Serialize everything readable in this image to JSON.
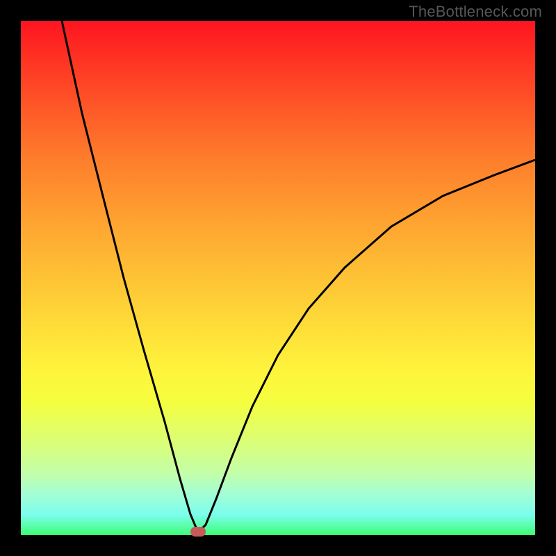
{
  "watermark": "TheBottleneck.com",
  "colors": {
    "frame_border": "#000000",
    "curve_stroke": "#000000",
    "marker_fill": "#c85a5a",
    "gradient_top": "#fe1420",
    "gradient_bottom": "#3cfe74"
  },
  "chart_data": {
    "type": "line",
    "title": "",
    "xlabel": "",
    "ylabel": "",
    "xlim": [
      0,
      100
    ],
    "ylim": [
      0,
      100
    ],
    "note": "No axis ticks or numeric labels are shown; x and y are expressed as percent of plot area. y=0 is the bottom (green/optimal), y=100 is the top (red/bottleneck).",
    "series": [
      {
        "name": "bottleneck-curve",
        "x": [
          8,
          12,
          16,
          20,
          24,
          28,
          31,
          33,
          34.5,
          36,
          38,
          41,
          45,
          50,
          56,
          63,
          72,
          82,
          92,
          100
        ],
        "y": [
          100,
          82,
          66,
          50,
          36,
          22,
          11,
          4,
          0.5,
          2,
          7,
          15,
          25,
          35,
          44,
          52,
          60,
          66,
          70,
          73
        ]
      }
    ],
    "marker": {
      "name": "optimal-point",
      "x": 34.5,
      "y": 0.5
    }
  }
}
